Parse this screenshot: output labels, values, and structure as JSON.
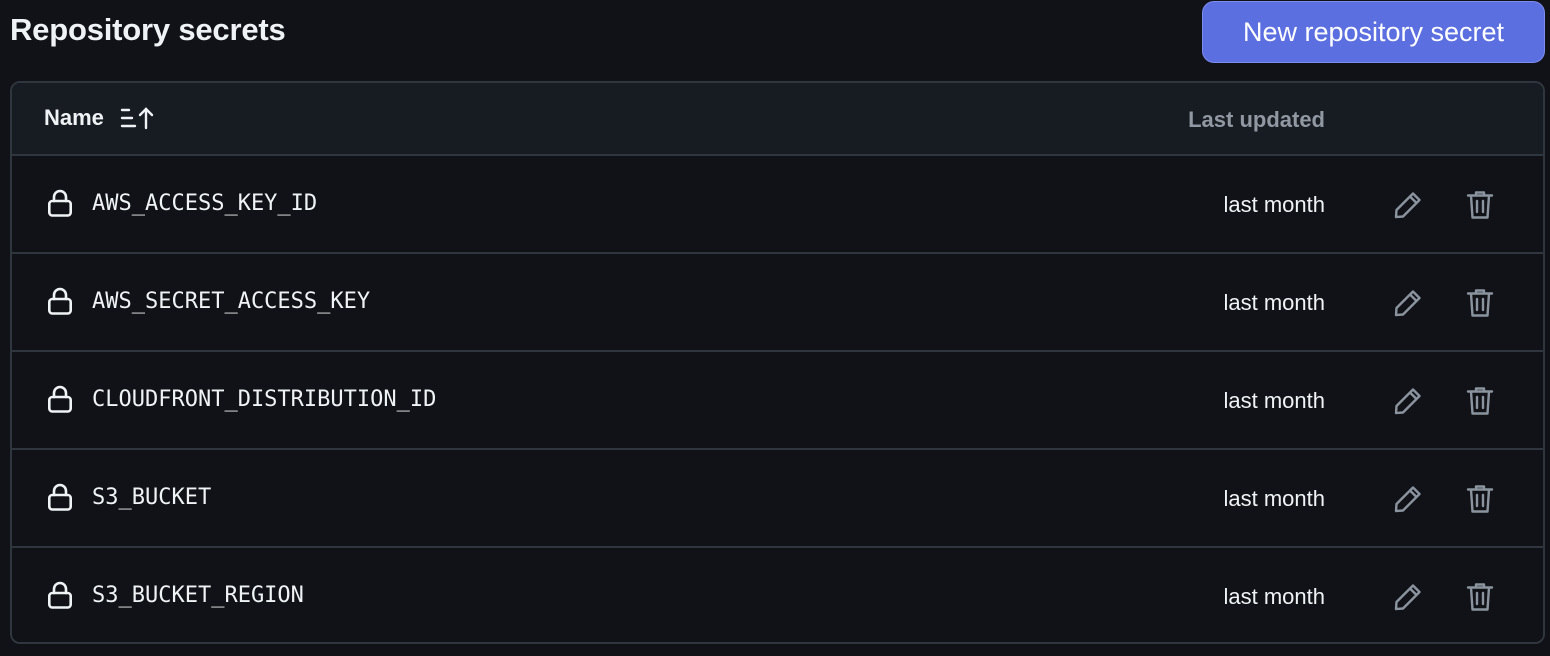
{
  "page": {
    "title": "Repository secrets",
    "new_button_label": "New repository secret"
  },
  "table": {
    "columns": {
      "name": "Name",
      "last_updated": "Last updated"
    },
    "rows": [
      {
        "name": "AWS_ACCESS_KEY_ID",
        "updated": "last month"
      },
      {
        "name": "AWS_SECRET_ACCESS_KEY",
        "updated": "last month"
      },
      {
        "name": "CLOUDFRONT_DISTRIBUTION_ID",
        "updated": "last month"
      },
      {
        "name": "S3_BUCKET",
        "updated": "last month"
      },
      {
        "name": "S3_BUCKET_REGION",
        "updated": "last month"
      }
    ]
  },
  "icons": {
    "row_leading": "lock-icon",
    "row_actions": [
      "pencil-icon",
      "trash-icon"
    ],
    "sort": "sort-ascending-icon"
  },
  "colors": {
    "background": "#111217",
    "header_background": "#171b22",
    "border": "#30363d",
    "accent_button": "#5b6fe0",
    "muted_text": "#9198a1"
  }
}
